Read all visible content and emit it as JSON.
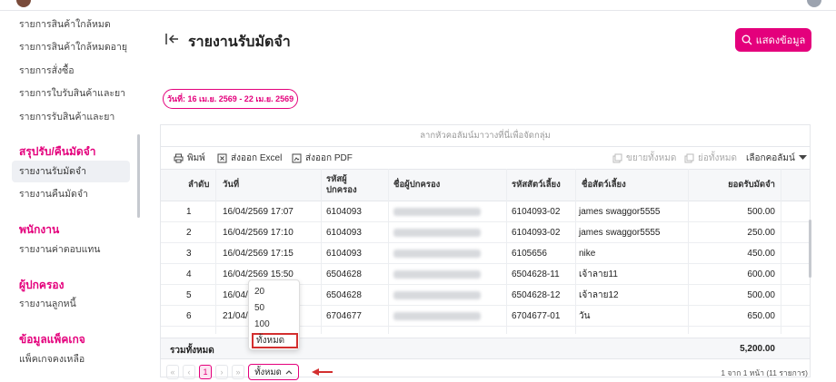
{
  "sidebar": {
    "items_top": [
      "รายการสินค้าใกล้หมด",
      "รายการสินค้าใกล้หมดอายุ",
      "รายการสั่งซื้อ",
      "รายการใบรับสินค้าและยา",
      "รายการรับสินค้าและยา"
    ],
    "section_deposit": "สรุปรับ/คืนมัดจำ",
    "items_deposit": [
      "รายงานรับมัดจำ",
      "รายงานคืนมัดจำ"
    ],
    "section_staff": "พนักงาน",
    "items_staff": [
      "รายงานค่าตอบแทน"
    ],
    "section_guardian": "ผู้ปกครอง",
    "items_guardian": [
      "รายงานลูกหนี้"
    ],
    "section_package": "ข้อมูลแพ็คเกจ",
    "items_package": [
      "แพ็คเกจคงเหลือ"
    ]
  },
  "header": {
    "title": "รายงานรับมัดจำ",
    "show_button": "แสดงข้อมูล",
    "date_range": "วันที่: 16 เม.ย. 2569 - 22 เม.ย. 2569"
  },
  "table": {
    "group_hint": "ลากหัวคอลัมน์มาวางที่นี่เพื่อจัดกลุ่ม",
    "toolbar": {
      "print": "พิมพ์",
      "export_excel": "ส่งออก Excel",
      "export_pdf": "ส่งออก PDF",
      "expand_all": "ขยายทั้งหมด",
      "collapse_all": "ย่อทั้งหมด",
      "choose_columns": "เลือกคอลัมน์"
    },
    "columns": [
      "ลำดับ",
      "วันที่",
      "รหัสผู้ปกครอง",
      "ชื่อผู้ปกครอง",
      "รหัสสัตว์เลี้ยง",
      "ชื่อสัตว์เลี้ยง",
      "ยอดรับมัดจำ"
    ],
    "rows": [
      {
        "no": "1",
        "date": "16/04/2569 17:07",
        "guardian_code": "6104093",
        "pet_code": "6104093-02",
        "pet_name": "james swaggor5555",
        "amount": "500.00"
      },
      {
        "no": "2",
        "date": "16/04/2569 17:10",
        "guardian_code": "6104093",
        "pet_code": "6104093-02",
        "pet_name": "james swaggor5555",
        "amount": "250.00"
      },
      {
        "no": "3",
        "date": "16/04/2569 17:15",
        "guardian_code": "6104093",
        "pet_code": "6105656",
        "pet_name": "nike",
        "amount": "450.00"
      },
      {
        "no": "4",
        "date": "16/04/2569 15:50",
        "guardian_code": "6504628",
        "pet_code": "6504628-11",
        "pet_name": "เจ้าลาย11",
        "amount": "600.00"
      },
      {
        "no": "5",
        "date": "16/04/",
        "guardian_code": "6504628",
        "pet_code": "6504628-12",
        "pet_name": "เจ้าลาย12",
        "amount": "500.00"
      },
      {
        "no": "6",
        "date": "21/04/",
        "guardian_code": "6704677",
        "pet_code": "6704677-01",
        "pet_name": "วัน",
        "amount": "650.00"
      }
    ],
    "total_label": "รวมทั้งหมด",
    "total_value": "5,200.00"
  },
  "pager": {
    "first": "«",
    "prev": "‹",
    "current_page": "1",
    "next": "›",
    "last": "»",
    "page_size": "ทั้งหมด",
    "info": "1 จาก 1 หน้า (11 รายการ)",
    "options": [
      "20",
      "50",
      "100",
      "ทั้งหมด"
    ]
  },
  "colors": {
    "accent": "#e4007c",
    "highlight": "#d32f2f"
  }
}
